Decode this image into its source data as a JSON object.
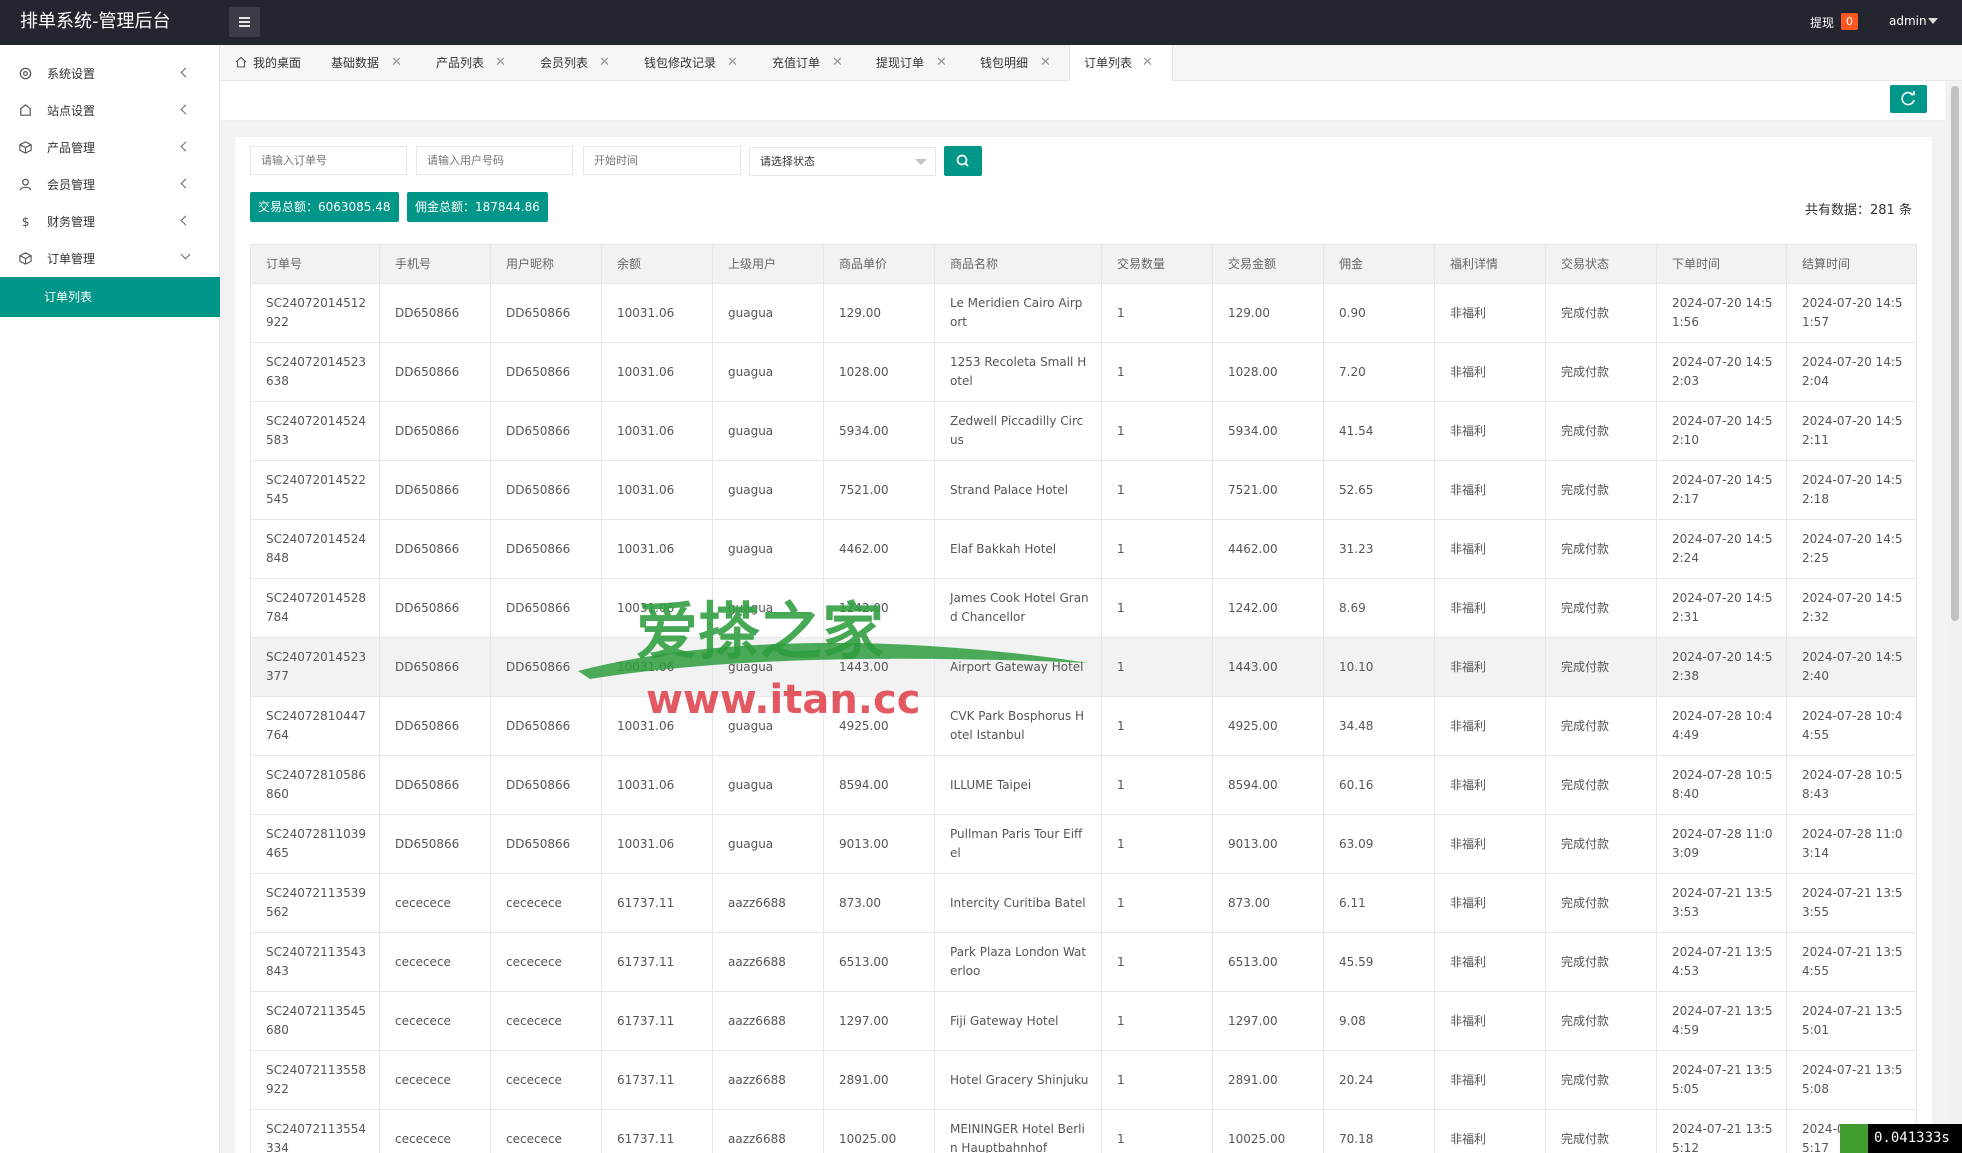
{
  "header": {
    "title": "排单系统-管理后台",
    "withdraw_label": "提现",
    "withdraw_count": "0",
    "user": "admin"
  },
  "sidebar": {
    "items": [
      {
        "label": "系统设置",
        "icon": "gear-icon"
      },
      {
        "label": "站点设置",
        "icon": "site-icon"
      },
      {
        "label": "产品管理",
        "icon": "box-icon"
      },
      {
        "label": "会员管理",
        "icon": "user-icon"
      },
      {
        "label": "财务管理",
        "icon": "dollar-icon"
      },
      {
        "label": "订单管理",
        "icon": "box-icon"
      }
    ],
    "active_sub": "订单列表"
  },
  "tabs": [
    {
      "label": "我的桌面",
      "closable": false
    },
    {
      "label": "基础数据",
      "closable": true
    },
    {
      "label": "产品列表",
      "closable": true
    },
    {
      "label": "会员列表",
      "closable": true
    },
    {
      "label": "钱包修改记录",
      "closable": true
    },
    {
      "label": "充值订单",
      "closable": true
    },
    {
      "label": "提现订单",
      "closable": true
    },
    {
      "label": "钱包明细",
      "closable": true
    },
    {
      "label": "订单列表",
      "closable": true,
      "active": true
    }
  ],
  "filters": {
    "order_no_placeholder": "请输入订单号",
    "user_no_placeholder": "请输入用户号码",
    "start_time_placeholder": "开始时间",
    "status_placeholder": "请选择状态"
  },
  "stats": {
    "trade_total": "交易总额：6063085.48",
    "commission_total": "佣金总额：187844.86",
    "count_text": "共有数据：281 条"
  },
  "table": {
    "columns": [
      "订单号",
      "手机号",
      "用户昵称",
      "余额",
      "上级用户",
      "商品单价",
      "商品名称",
      "交易数量",
      "交易金额",
      "佣金",
      "福利详情",
      "交易状态",
      "下单时间",
      "结算时间"
    ],
    "rows": [
      [
        "SC24072014512922",
        "DD650866",
        "DD650866",
        "10031.06",
        "guagua",
        "129.00",
        "Le Meridien Cairo Airport",
        "1",
        "129.00",
        "0.90",
        "非福利",
        "完成付款",
        "2024-07-20 14:51:56",
        "2024-07-20 14:51:57"
      ],
      [
        "SC24072014523638",
        "DD650866",
        "DD650866",
        "10031.06",
        "guagua",
        "1028.00",
        "1253 Recoleta Small Hotel",
        "1",
        "1028.00",
        "7.20",
        "非福利",
        "完成付款",
        "2024-07-20 14:52:03",
        "2024-07-20 14:52:04"
      ],
      [
        "SC24072014524583",
        "DD650866",
        "DD650866",
        "10031.06",
        "guagua",
        "5934.00",
        "Zedwell Piccadilly Circus",
        "1",
        "5934.00",
        "41.54",
        "非福利",
        "完成付款",
        "2024-07-20 14:52:10",
        "2024-07-20 14:52:11"
      ],
      [
        "SC24072014522545",
        "DD650866",
        "DD650866",
        "10031.06",
        "guagua",
        "7521.00",
        "Strand Palace Hotel",
        "1",
        "7521.00",
        "52.65",
        "非福利",
        "完成付款",
        "2024-07-20 14:52:17",
        "2024-07-20 14:52:18"
      ],
      [
        "SC24072014524848",
        "DD650866",
        "DD650866",
        "10031.06",
        "guagua",
        "4462.00",
        "Elaf Bakkah Hotel",
        "1",
        "4462.00",
        "31.23",
        "非福利",
        "完成付款",
        "2024-07-20 14:52:24",
        "2024-07-20 14:52:25"
      ],
      [
        "SC24072014528784",
        "DD650866",
        "DD650866",
        "10031.06",
        "guagua",
        "1242.00",
        "James Cook Hotel Grand Chancellor",
        "1",
        "1242.00",
        "8.69",
        "非福利",
        "完成付款",
        "2024-07-20 14:52:31",
        "2024-07-20 14:52:32"
      ],
      [
        "SC24072014523377",
        "DD650866",
        "DD650866",
        "10031.06",
        "guagua",
        "1443.00",
        "Airport Gateway Hotel",
        "1",
        "1443.00",
        "10.10",
        "非福利",
        "完成付款",
        "2024-07-20 14:52:38",
        "2024-07-20 14:52:40"
      ],
      [
        "SC24072810447764",
        "DD650866",
        "DD650866",
        "10031.06",
        "guagua",
        "4925.00",
        "CVK Park Bosphorus Hotel Istanbul",
        "1",
        "4925.00",
        "34.48",
        "非福利",
        "完成付款",
        "2024-07-28 10:44:49",
        "2024-07-28 10:44:55"
      ],
      [
        "SC24072810586860",
        "DD650866",
        "DD650866",
        "10031.06",
        "guagua",
        "8594.00",
        "ILLUME Taipei",
        "1",
        "8594.00",
        "60.16",
        "非福利",
        "完成付款",
        "2024-07-28 10:58:40",
        "2024-07-28 10:58:43"
      ],
      [
        "SC24072811039465",
        "DD650866",
        "DD650866",
        "10031.06",
        "guagua",
        "9013.00",
        "Pullman Paris Tour Eiffel",
        "1",
        "9013.00",
        "63.09",
        "非福利",
        "完成付款",
        "2024-07-28 11:03:09",
        "2024-07-28 11:03:14"
      ],
      [
        "SC24072113539562",
        "cececece",
        "cececece",
        "61737.11",
        "aazz6688",
        "873.00",
        "Intercity Curitiba Batel",
        "1",
        "873.00",
        "6.11",
        "非福利",
        "完成付款",
        "2024-07-21 13:53:53",
        "2024-07-21 13:53:55"
      ],
      [
        "SC24072113543843",
        "cececece",
        "cececece",
        "61737.11",
        "aazz6688",
        "6513.00",
        "Park Plaza London Waterloo",
        "1",
        "6513.00",
        "45.59",
        "非福利",
        "完成付款",
        "2024-07-21 13:54:53",
        "2024-07-21 13:54:55"
      ],
      [
        "SC24072113545680",
        "cececece",
        "cececece",
        "61737.11",
        "aazz6688",
        "1297.00",
        "Fiji Gateway Hotel",
        "1",
        "1297.00",
        "9.08",
        "非福利",
        "完成付款",
        "2024-07-21 13:54:59",
        "2024-07-21 13:55:01"
      ],
      [
        "SC24072113558922",
        "cececece",
        "cececece",
        "61737.11",
        "aazz6688",
        "2891.00",
        "Hotel Gracery Shinjuku",
        "1",
        "2891.00",
        "20.24",
        "非福利",
        "完成付款",
        "2024-07-21 13:55:05",
        "2024-07-21 13:55:08"
      ],
      [
        "SC24072113554334",
        "cececece",
        "cececece",
        "61737.11",
        "aazz6688",
        "10025.00",
        "MEININGER Hotel Berlin Hauptbahnhof",
        "1",
        "10025.00",
        "70.18",
        "非福利",
        "完成付款",
        "2024-07-21 13:55:12",
        "2024-07-21 13:55:17"
      ]
    ]
  },
  "watermark": {
    "title": "爱搽之家",
    "url": "www.itan.cc"
  },
  "timer": "0.041333s",
  "colors": {
    "accent": "#009688",
    "header_bg": "#23262e",
    "badge": "#ff5722"
  }
}
